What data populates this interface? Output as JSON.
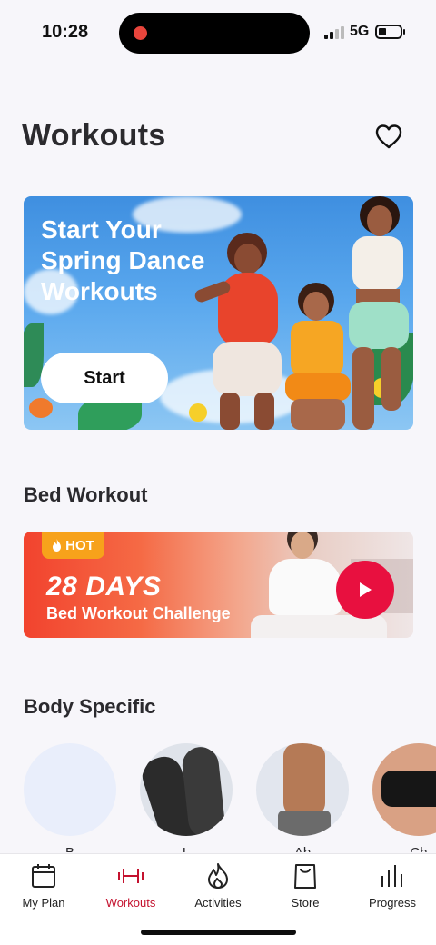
{
  "status_bar": {
    "time": "10:28",
    "network": "5G"
  },
  "header": {
    "title": "Workouts",
    "favorite_icon": "heart-icon"
  },
  "hero": {
    "title": "Start Your Spring Dance Workouts",
    "button_label": "Start"
  },
  "bed_section": {
    "title": "Bed Workout",
    "badge": "HOT",
    "days": "28 DAYS",
    "subtitle": "Bed Workout Challenge",
    "play_icon": "play-icon"
  },
  "body_section": {
    "title": "Body Specific",
    "items": [
      {
        "label": "B"
      },
      {
        "label": "L"
      },
      {
        "label": "Ab"
      },
      {
        "label": "Ch"
      }
    ]
  },
  "tab_bar": {
    "items": [
      {
        "label": "My Plan",
        "icon": "calendar-icon"
      },
      {
        "label": "Workouts",
        "icon": "dumbbell-icon",
        "active": true
      },
      {
        "label": "Activities",
        "icon": "flame-icon"
      },
      {
        "label": "Store",
        "icon": "shopping-bag-icon"
      },
      {
        "label": "Progress",
        "icon": "bar-chart-icon"
      }
    ]
  },
  "colors": {
    "accent": "#c4122f",
    "play": "#e8103f",
    "hot": "#f7a21b"
  }
}
